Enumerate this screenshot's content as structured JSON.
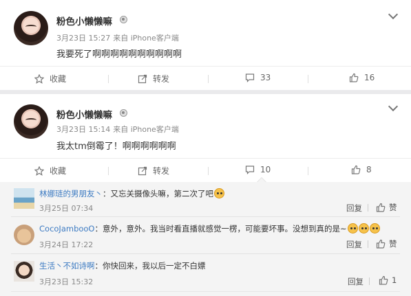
{
  "posts": [
    {
      "username": "粉色小懒懒嘛",
      "date": "3月23日 15:27",
      "source": "来自 iPhone客户端",
      "text": "我要死了啊啊啊啊啊啊啊啊啊啊",
      "actions": {
        "favorite": "收藏",
        "repost": "转发",
        "comments": "33",
        "likes": "16"
      }
    },
    {
      "username": "粉色小懒懒嘛",
      "date": "3月23日 15:14",
      "source": "来自 iPhone客户端",
      "text": "我太tm倒霉了！啊啊啊啊啊啊",
      "actions": {
        "favorite": "收藏",
        "repost": "转发",
        "comments": "10",
        "likes": "8"
      }
    }
  ],
  "comments": [
    {
      "name": "林娜琏的男朋友丶",
      "text": "：又忘关摄像头嘛，第二次了吧",
      "emoji_count": 1,
      "time": "3月25日 07:34",
      "reply": "回复",
      "like": "赞"
    },
    {
      "name": "CocoJambooO",
      "text": "：意外，意外。我当时看直播就感觉一楞，可能要坏事。没想到真的是~",
      "emoji_count": 3,
      "time": "3月24日 17:22",
      "reply": "回复",
      "like": "赞"
    },
    {
      "name": "生活丶不如诗啊",
      "text": "：你快回来，我以后一定不白嫖",
      "emoji_count": 0,
      "time": "3月23日 15:32",
      "reply": "回复",
      "like": "1"
    }
  ],
  "icons": {
    "favorite": "star-icon",
    "repost": "share-icon",
    "comment": "comment-icon",
    "like": "thumbs-up-icon",
    "menu": "chevron-down-icon",
    "badge": "vip-badge-icon"
  },
  "colors": {
    "link": "#3d7bc2",
    "comment_bg": "#f4f4f4",
    "page_bg": "#eaeaec",
    "emoji": "#f6c24a"
  }
}
